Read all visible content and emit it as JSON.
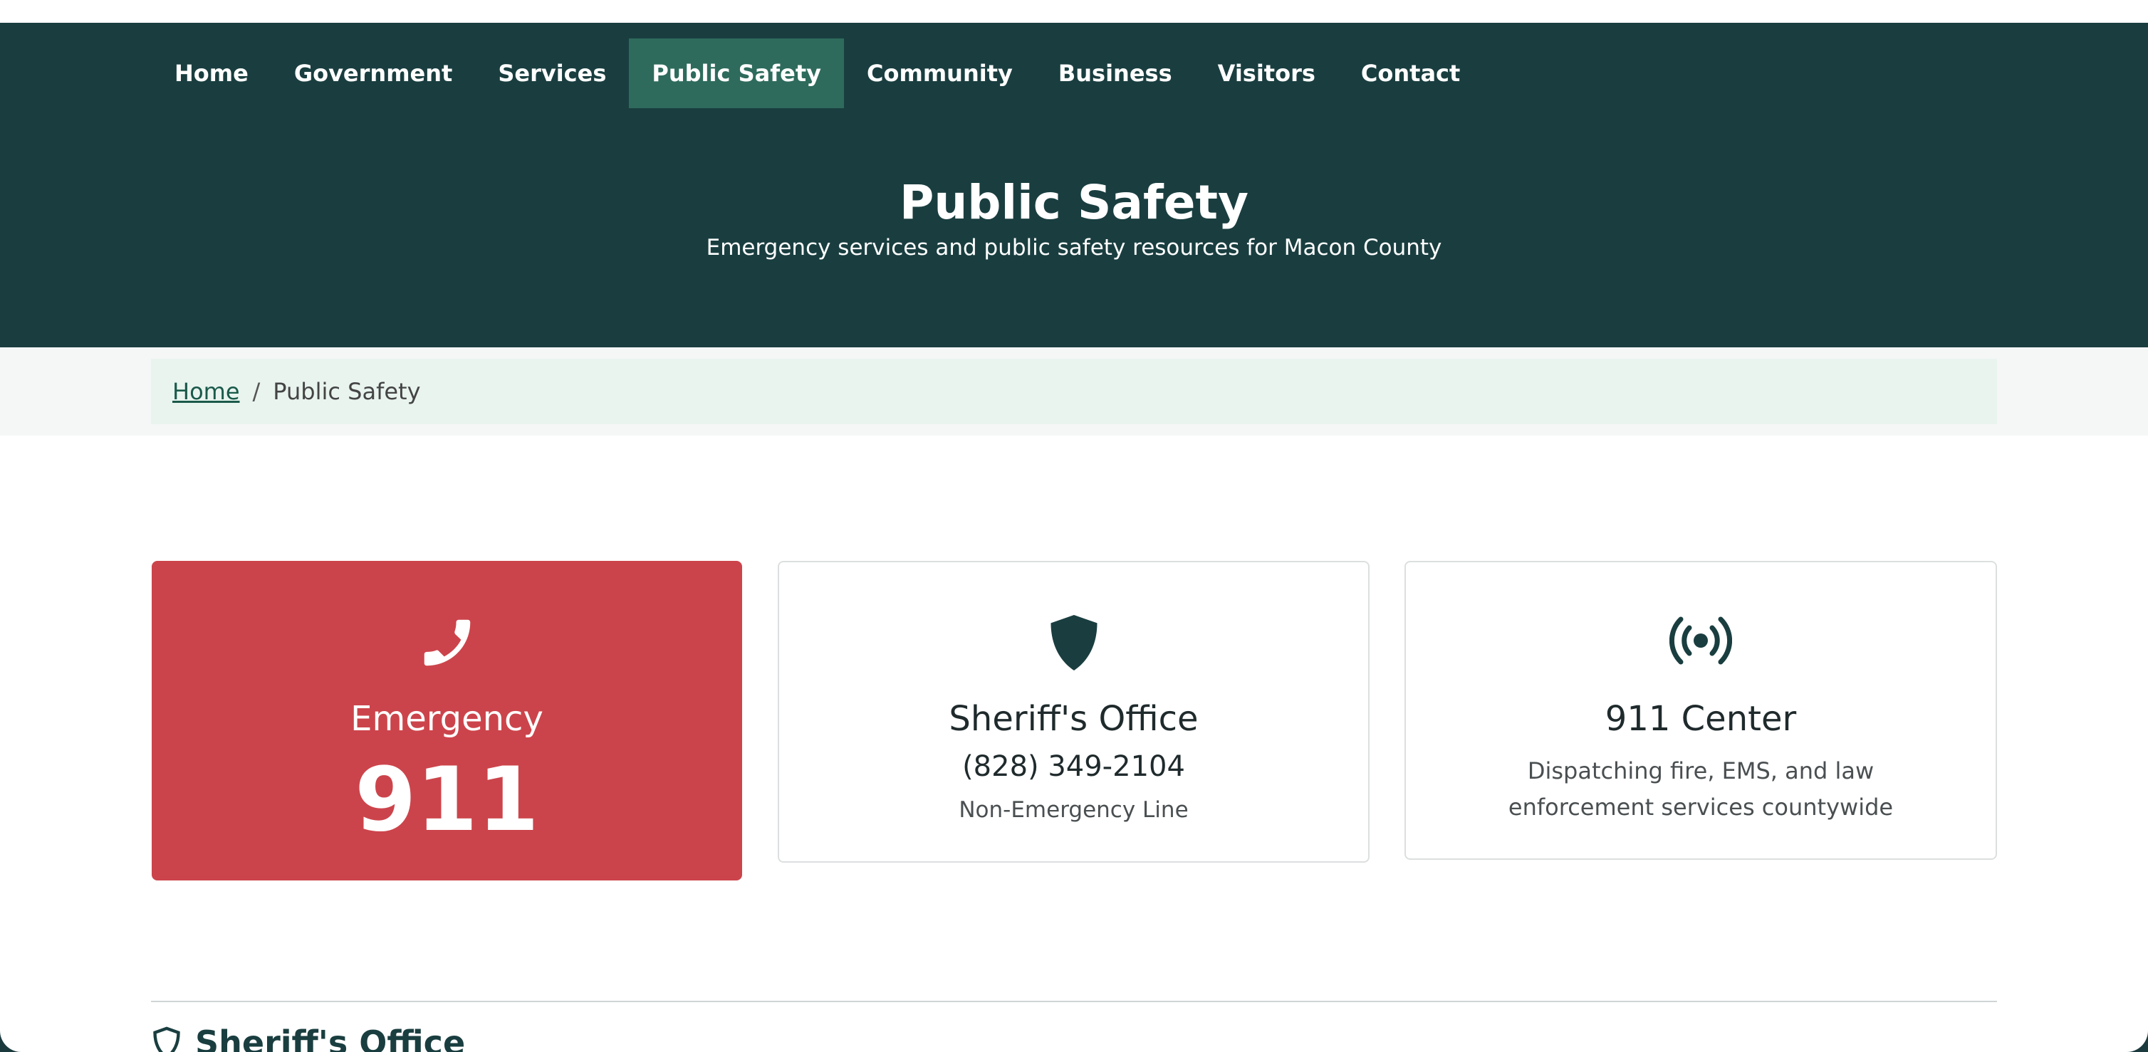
{
  "nav": {
    "items": [
      {
        "label": "Home"
      },
      {
        "label": "Government"
      },
      {
        "label": "Services"
      },
      {
        "label": "Public Safety"
      },
      {
        "label": "Community"
      },
      {
        "label": "Business"
      },
      {
        "label": "Visitors"
      },
      {
        "label": "Contact"
      }
    ],
    "active": "Public Safety"
  },
  "hero": {
    "title": "Public Safety",
    "subtitle": "Emergency services and public safety resources for Macon County"
  },
  "breadcrumb": {
    "home": "Home",
    "separator": "/",
    "current": "Public Safety"
  },
  "cards": {
    "emergency": {
      "icon": "phone-icon",
      "title": "Emergency",
      "number": "911"
    },
    "sheriff": {
      "icon": "shield-icon",
      "title": "Sheriff's Office",
      "phone": "(828) 349-2104",
      "note": "Non-Emergency Line"
    },
    "center": {
      "icon": "broadcast-icon",
      "title": "911 Center",
      "description": "Dispatching fire, EMS, and law enforcement services countywide"
    }
  },
  "section": {
    "icon": "shield-outline-icon",
    "title": "Sheriff's Office"
  },
  "colors": {
    "header": "#1a3e40",
    "nav_active": "#2e6b5c",
    "emergency": "#cc444b",
    "breadcrumb_bg": "#e9f4ef"
  }
}
